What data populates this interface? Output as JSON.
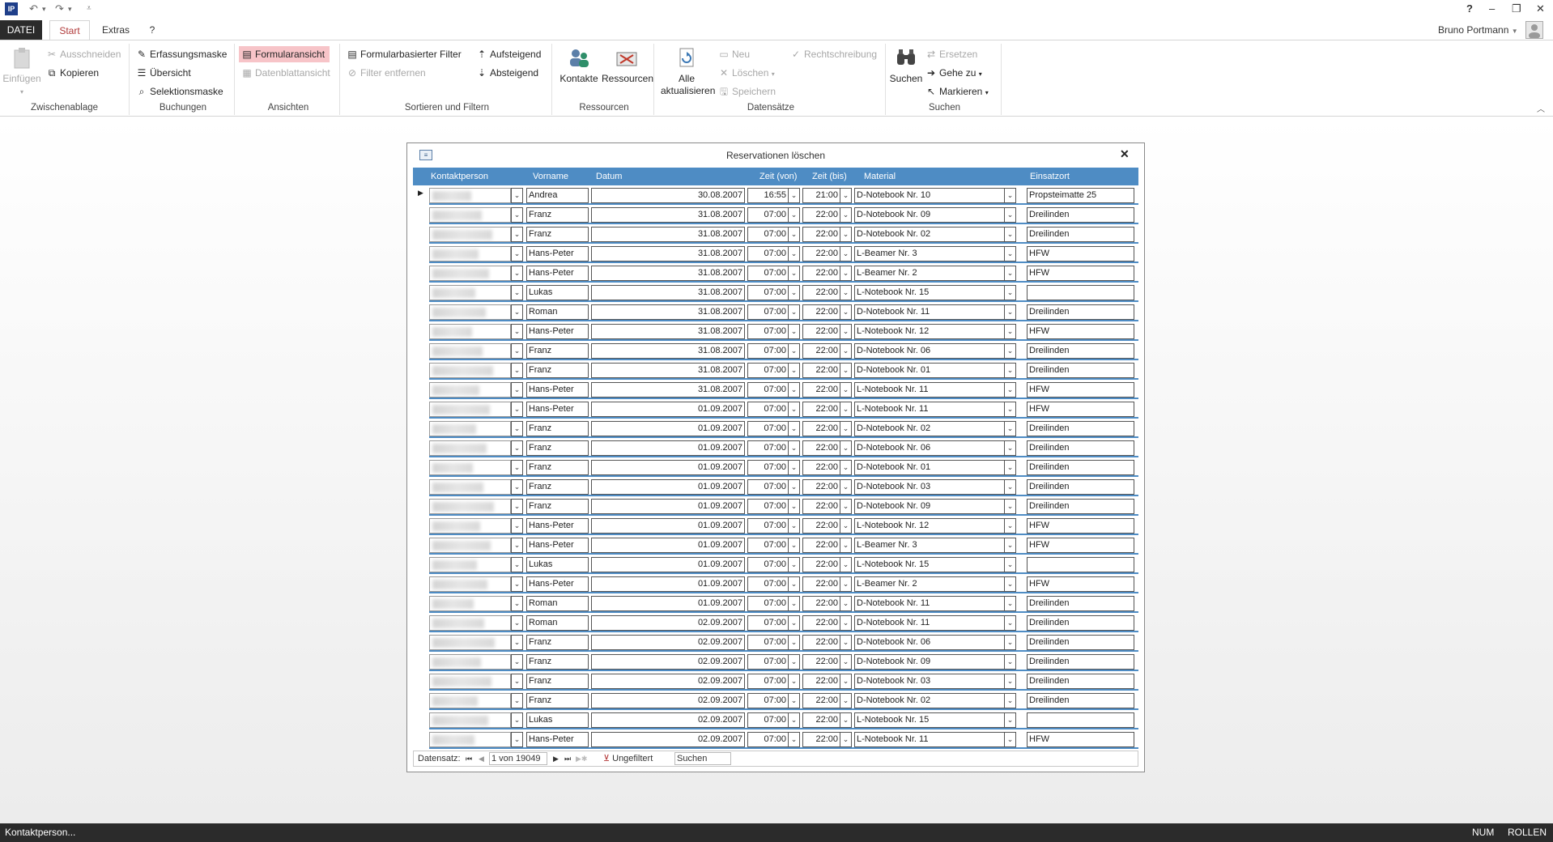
{
  "app": {
    "logo": "IP",
    "user": "Bruno Portmann",
    "help": "?",
    "min": "–",
    "restore": "❐",
    "close": "✕"
  },
  "tabs": [
    {
      "label": "DATEI"
    },
    {
      "label": "Start"
    },
    {
      "label": "Extras"
    },
    {
      "label": "?"
    }
  ],
  "ribbon": {
    "clipboard": {
      "label": "Zwischenablage",
      "paste": "Einfügen",
      "cut": "Ausschneiden",
      "copy": "Kopieren"
    },
    "bookings": {
      "label": "Buchungen",
      "entry": "Erfassungsmaske",
      "overview": "Übersicht",
      "selection": "Selektionsmaske"
    },
    "views": {
      "label": "Ansichten",
      "form": "Formularansicht",
      "datasheet": "Datenblattansicht"
    },
    "sortfilter": {
      "label": "Sortieren und Filtern",
      "formfilter": "Formularbasierter Filter",
      "removefilter": "Filter entfernen",
      "asc": "Aufsteigend",
      "desc": "Absteigend"
    },
    "resources": {
      "label": "Ressourcen",
      "contacts": "Kontakte",
      "resources": "Ressourcen"
    },
    "records": {
      "label": "Datensätze",
      "refresh": "Alle aktualisieren",
      "new": "Neu",
      "delete": "Löschen",
      "save": "Speichern",
      "spelling": "Rechtschreibung"
    },
    "search": {
      "label": "Suchen",
      "find": "Suchen",
      "replace": "Ersetzen",
      "goto": "Gehe zu",
      "select": "Markieren"
    }
  },
  "dialog": {
    "title": "Reservationen löschen",
    "close": "✕",
    "columns": {
      "kontakt": "Kontaktperson",
      "vorname": "Vorname",
      "datum": "Datum",
      "von": "Zeit (von)",
      "bis": "Zeit (bis)",
      "material": "Material",
      "ort": "Einsatzort"
    },
    "rows": [
      {
        "vorname": "Andrea",
        "datum": "30.08.2007",
        "von": "16:55",
        "bis": "21:00",
        "material": "D-Notebook Nr. 10",
        "ort": "Propsteimatte 25"
      },
      {
        "vorname": "Franz",
        "datum": "31.08.2007",
        "von": "07:00",
        "bis": "22:00",
        "material": "D-Notebook Nr. 09",
        "ort": "Dreilinden"
      },
      {
        "vorname": "Franz",
        "datum": "31.08.2007",
        "von": "07:00",
        "bis": "22:00",
        "material": "D-Notebook Nr. 02",
        "ort": "Dreilinden"
      },
      {
        "vorname": "Hans-Peter",
        "datum": "31.08.2007",
        "von": "07:00",
        "bis": "22:00",
        "material": "L-Beamer Nr. 3",
        "ort": "HFW"
      },
      {
        "vorname": "Hans-Peter",
        "datum": "31.08.2007",
        "von": "07:00",
        "bis": "22:00",
        "material": "L-Beamer Nr. 2",
        "ort": "HFW"
      },
      {
        "vorname": "Lukas",
        "datum": "31.08.2007",
        "von": "07:00",
        "bis": "22:00",
        "material": "L-Notebook Nr. 15",
        "ort": ""
      },
      {
        "vorname": "Roman",
        "datum": "31.08.2007",
        "von": "07:00",
        "bis": "22:00",
        "material": "D-Notebook Nr. 11",
        "ort": "Dreilinden"
      },
      {
        "vorname": "Hans-Peter",
        "datum": "31.08.2007",
        "von": "07:00",
        "bis": "22:00",
        "material": "L-Notebook Nr. 12",
        "ort": "HFW"
      },
      {
        "vorname": "Franz",
        "datum": "31.08.2007",
        "von": "07:00",
        "bis": "22:00",
        "material": "D-Notebook Nr. 06",
        "ort": "Dreilinden"
      },
      {
        "vorname": "Franz",
        "datum": "31.08.2007",
        "von": "07:00",
        "bis": "22:00",
        "material": "D-Notebook Nr. 01",
        "ort": "Dreilinden"
      },
      {
        "vorname": "Hans-Peter",
        "datum": "31.08.2007",
        "von": "07:00",
        "bis": "22:00",
        "material": "L-Notebook Nr. 11",
        "ort": "HFW"
      },
      {
        "vorname": "Hans-Peter",
        "datum": "01.09.2007",
        "von": "07:00",
        "bis": "22:00",
        "material": "L-Notebook Nr. 11",
        "ort": "HFW"
      },
      {
        "vorname": "Franz",
        "datum": "01.09.2007",
        "von": "07:00",
        "bis": "22:00",
        "material": "D-Notebook Nr. 02",
        "ort": "Dreilinden"
      },
      {
        "vorname": "Franz",
        "datum": "01.09.2007",
        "von": "07:00",
        "bis": "22:00",
        "material": "D-Notebook Nr. 06",
        "ort": "Dreilinden"
      },
      {
        "vorname": "Franz",
        "datum": "01.09.2007",
        "von": "07:00",
        "bis": "22:00",
        "material": "D-Notebook Nr. 01",
        "ort": "Dreilinden"
      },
      {
        "vorname": "Franz",
        "datum": "01.09.2007",
        "von": "07:00",
        "bis": "22:00",
        "material": "D-Notebook Nr. 03",
        "ort": "Dreilinden"
      },
      {
        "vorname": "Franz",
        "datum": "01.09.2007",
        "von": "07:00",
        "bis": "22:00",
        "material": "D-Notebook Nr. 09",
        "ort": "Dreilinden"
      },
      {
        "vorname": "Hans-Peter",
        "datum": "01.09.2007",
        "von": "07:00",
        "bis": "22:00",
        "material": "L-Notebook Nr. 12",
        "ort": "HFW"
      },
      {
        "vorname": "Hans-Peter",
        "datum": "01.09.2007",
        "von": "07:00",
        "bis": "22:00",
        "material": "L-Beamer Nr. 3",
        "ort": "HFW"
      },
      {
        "vorname": "Lukas",
        "datum": "01.09.2007",
        "von": "07:00",
        "bis": "22:00",
        "material": "L-Notebook Nr. 15",
        "ort": ""
      },
      {
        "vorname": "Hans-Peter",
        "datum": "01.09.2007",
        "von": "07:00",
        "bis": "22:00",
        "material": "L-Beamer Nr. 2",
        "ort": "HFW"
      },
      {
        "vorname": "Roman",
        "datum": "01.09.2007",
        "von": "07:00",
        "bis": "22:00",
        "material": "D-Notebook Nr. 11",
        "ort": "Dreilinden"
      },
      {
        "vorname": "Roman",
        "datum": "02.09.2007",
        "von": "07:00",
        "bis": "22:00",
        "material": "D-Notebook Nr. 11",
        "ort": "Dreilinden"
      },
      {
        "vorname": "Franz",
        "datum": "02.09.2007",
        "von": "07:00",
        "bis": "22:00",
        "material": "D-Notebook Nr. 06",
        "ort": "Dreilinden"
      },
      {
        "vorname": "Franz",
        "datum": "02.09.2007",
        "von": "07:00",
        "bis": "22:00",
        "material": "D-Notebook Nr. 09",
        "ort": "Dreilinden"
      },
      {
        "vorname": "Franz",
        "datum": "02.09.2007",
        "von": "07:00",
        "bis": "22:00",
        "material": "D-Notebook Nr. 03",
        "ort": "Dreilinden"
      },
      {
        "vorname": "Franz",
        "datum": "02.09.2007",
        "von": "07:00",
        "bis": "22:00",
        "material": "D-Notebook Nr. 02",
        "ort": "Dreilinden"
      },
      {
        "vorname": "Lukas",
        "datum": "02.09.2007",
        "von": "07:00",
        "bis": "22:00",
        "material": "L-Notebook Nr. 15",
        "ort": ""
      },
      {
        "vorname": "Hans-Peter",
        "datum": "02.09.2007",
        "von": "07:00",
        "bis": "22:00",
        "material": "L-Notebook Nr. 11",
        "ort": "HFW"
      }
    ]
  },
  "nav": {
    "label": "Datensatz:",
    "position": "1 von 19049",
    "filter": "Ungefiltert",
    "search": "Suchen"
  },
  "status": {
    "left": "Kontaktperson...",
    "num": "NUM",
    "scroll": "ROLLEN"
  },
  "colors": {
    "accent": "#4e8cc4",
    "ribbonSelected": "#f7c4c8",
    "darkTab": "#2b2b2b"
  }
}
